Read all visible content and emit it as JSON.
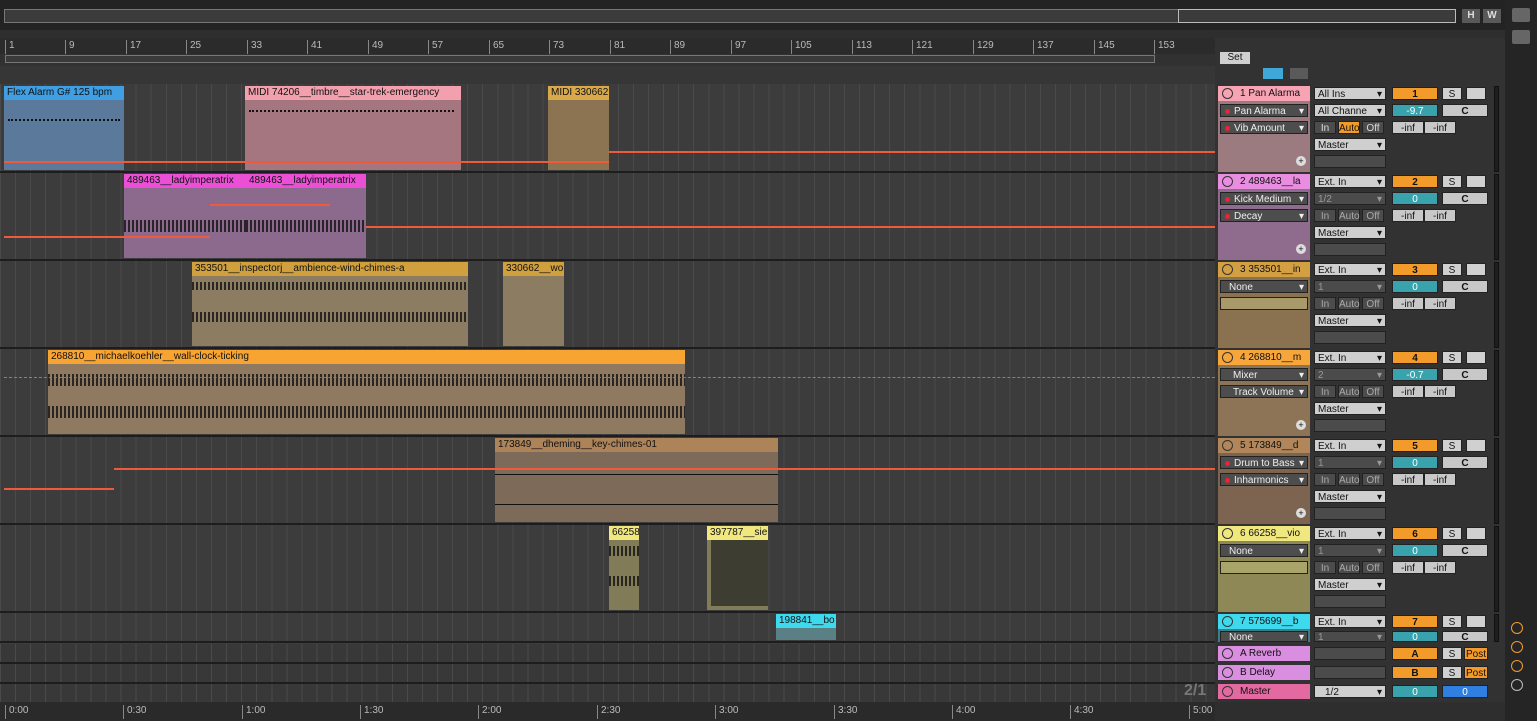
{
  "overview": {
    "h_btn": "H",
    "w_btn": "W"
  },
  "ruler": {
    "bars": [
      "1",
      "9",
      "17",
      "25",
      "33",
      "41",
      "49",
      "57",
      "65",
      "73",
      "81",
      "89",
      "97",
      "105",
      "113",
      "121",
      "129",
      "137",
      "145",
      "153"
    ]
  },
  "timeline": {
    "marks": [
      "0:00",
      "0:30",
      "1:00",
      "1:30",
      "2:00",
      "2:30",
      "3:00",
      "3:30",
      "4:00",
      "4:30",
      "5:00"
    ]
  },
  "set_label": "Set",
  "page_indicator": "2/1",
  "tracks": [
    {
      "header": "1 Pan Alarma",
      "color": "#f7a3b4",
      "input": "All Ins",
      "channel": "All Channe",
      "devices": [
        "Pan Alarma",
        "Vib Amount"
      ],
      "output": "Master",
      "number": "1",
      "volume": "-9.7",
      "pan": "C",
      "monitor": [
        "In",
        "Auto",
        "Off"
      ],
      "inf": [
        "-inf",
        "-inf"
      ]
    },
    {
      "header": "2 489463__la",
      "color": "#e98de0",
      "input": "Ext. In",
      "channel": "1/2",
      "devices": [
        "Kick Medium",
        "Decay"
      ],
      "output": "Master",
      "number": "2",
      "volume": "0",
      "pan": "C",
      "monitor": [
        "In",
        "Auto",
        "Off"
      ],
      "inf": [
        "-inf",
        "-inf"
      ]
    },
    {
      "header": "3 353501__in",
      "color": "#d2a043",
      "input": "Ext. In",
      "channel": "1",
      "devices": [
        "None"
      ],
      "output": "Master",
      "number": "3",
      "volume": "0",
      "pan": "C",
      "monitor": [
        "In",
        "Auto",
        "Off"
      ],
      "inf": [
        "-inf",
        "-inf"
      ]
    },
    {
      "header": "4 268810__m",
      "color": "#f6a63a",
      "input": "Ext. In",
      "channel": "2",
      "devices": [
        "Mixer",
        "Track Volume"
      ],
      "output": "Master",
      "number": "4",
      "volume": "-0.7",
      "pan": "C",
      "monitor": [
        "In",
        "Auto",
        "Off"
      ],
      "inf": [
        "-inf",
        "-inf"
      ]
    },
    {
      "header": "5 173849__d",
      "color": "#b0865a",
      "input": "Ext. In",
      "channel": "1",
      "devices": [
        "Drum to Bass",
        "Inharmonics"
      ],
      "output": "Master",
      "number": "5",
      "volume": "0",
      "pan": "C",
      "monitor": [
        "In",
        "Auto",
        "Off"
      ],
      "inf": [
        "-inf",
        "-inf"
      ]
    },
    {
      "header": "6 66258__vio",
      "color": "#f0e77f",
      "input": "Ext. In",
      "channel": "1",
      "devices": [
        "None"
      ],
      "output": "Master",
      "number": "6",
      "volume": "0",
      "pan": "C",
      "monitor": [
        "In",
        "Auto",
        "Off"
      ],
      "inf": [
        "-inf",
        "-inf"
      ]
    },
    {
      "header": "7 575699__b",
      "color": "#3fd9ee",
      "input": "Ext. In",
      "channel": "1",
      "devices": [
        "None"
      ],
      "output": "",
      "number": "7",
      "volume": "0",
      "pan": "C",
      "monitor": [],
      "inf": []
    }
  ],
  "returns": [
    {
      "header": "A Reverb",
      "number": "A",
      "send": "Post"
    },
    {
      "header": "B Delay",
      "number": "B",
      "send": "Post"
    }
  ],
  "master": {
    "header": "Master",
    "channel": "1/2",
    "vol_l": "0",
    "vol_r": "0"
  },
  "clips": [
    {
      "name": "Flex Alarm G# 125 bpm"
    },
    {
      "name": "MIDI 74206__timbre__star-trek-emergency"
    },
    {
      "name": "MIDI 330662"
    },
    {
      "name": "489463__ladyimperatrix"
    },
    {
      "name": "489463__ladyimperatrix"
    },
    {
      "name": "353501__inspectorj__ambience-wind-chimes-a"
    },
    {
      "name": "330662__wo"
    },
    {
      "name": "268810__michaelkoehler__wall-clock-ticking"
    },
    {
      "name": "173849__dheming__key-chimes-01"
    },
    {
      "name": "66258"
    },
    {
      "name": "397787__sie"
    },
    {
      "name": "198841__bo"
    }
  ],
  "solo_label": "S"
}
